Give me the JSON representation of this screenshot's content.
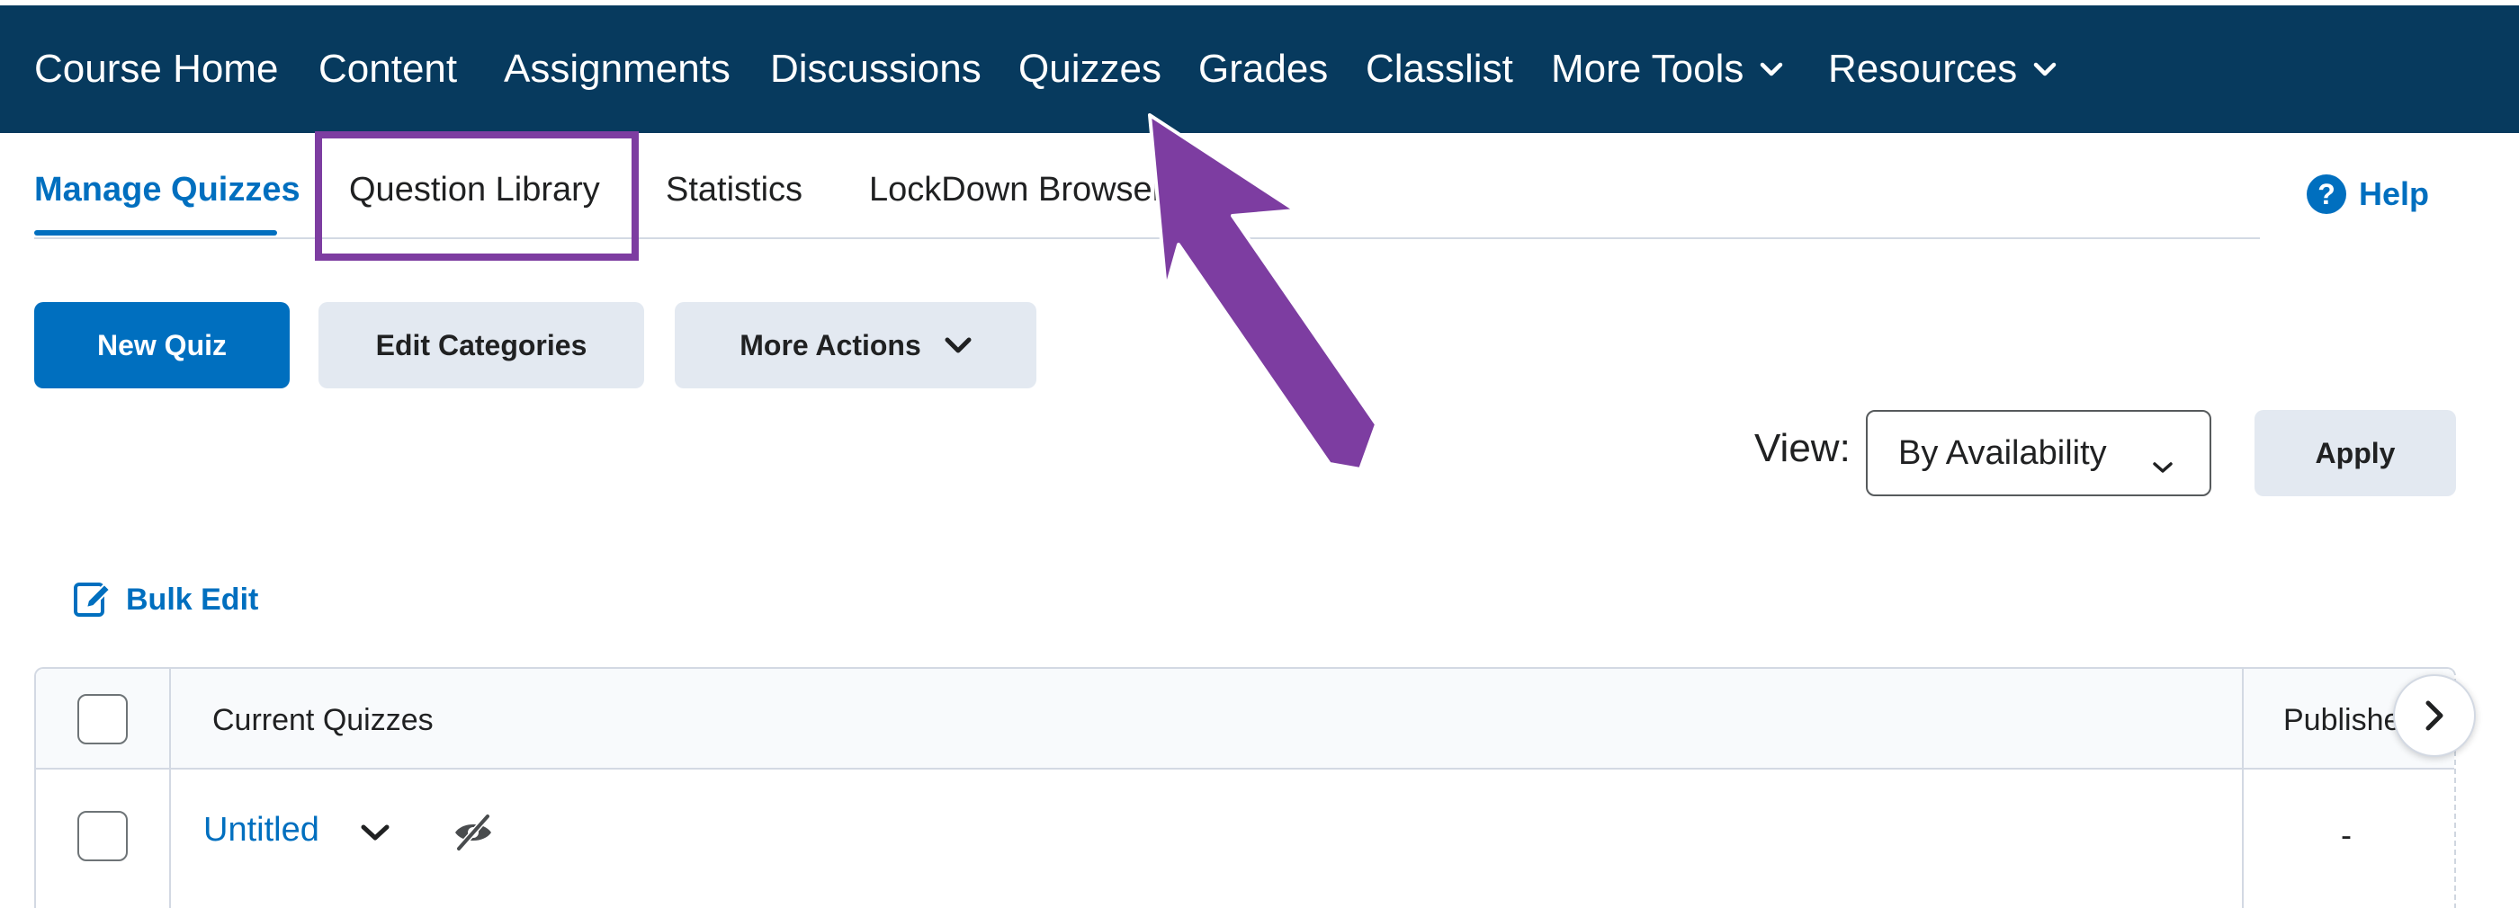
{
  "nav": {
    "items": [
      {
        "label": "Course Home"
      },
      {
        "label": "Content"
      },
      {
        "label": "Assignments"
      },
      {
        "label": "Discussions"
      },
      {
        "label": "Quizzes"
      },
      {
        "label": "Grades"
      },
      {
        "label": "Classlist"
      },
      {
        "label": "More Tools",
        "dropdown": true
      },
      {
        "label": "Resources",
        "dropdown": true
      }
    ]
  },
  "tabs": {
    "items": [
      {
        "label": "Manage Quizzes",
        "active": true
      },
      {
        "label": "Question Library",
        "highlighted": true
      },
      {
        "label": "Statistics"
      },
      {
        "label": "LockDown Browser"
      }
    ],
    "help_label": "Help",
    "help_icon": "question-circle-icon"
  },
  "toolbar": {
    "new_quiz": "New Quiz",
    "edit_categories": "Edit Categories",
    "more_actions": "More Actions"
  },
  "view": {
    "label": "View:",
    "selected": "By Availability",
    "apply": "Apply"
  },
  "bulk_edit": {
    "label": "Bulk Edit",
    "icon": "pencil-icon"
  },
  "table": {
    "headers": {
      "current_quizzes": "Current Quizzes",
      "published": "Publishe"
    },
    "rows": [
      {
        "name": "Untitled",
        "published": "-",
        "hidden_icon": "eye-slash-icon"
      }
    ]
  },
  "colors": {
    "navbar": "#073a5e",
    "accent": "#006fbf",
    "annotation": "#7d3da1",
    "button_secondary": "#e3e9f1"
  }
}
